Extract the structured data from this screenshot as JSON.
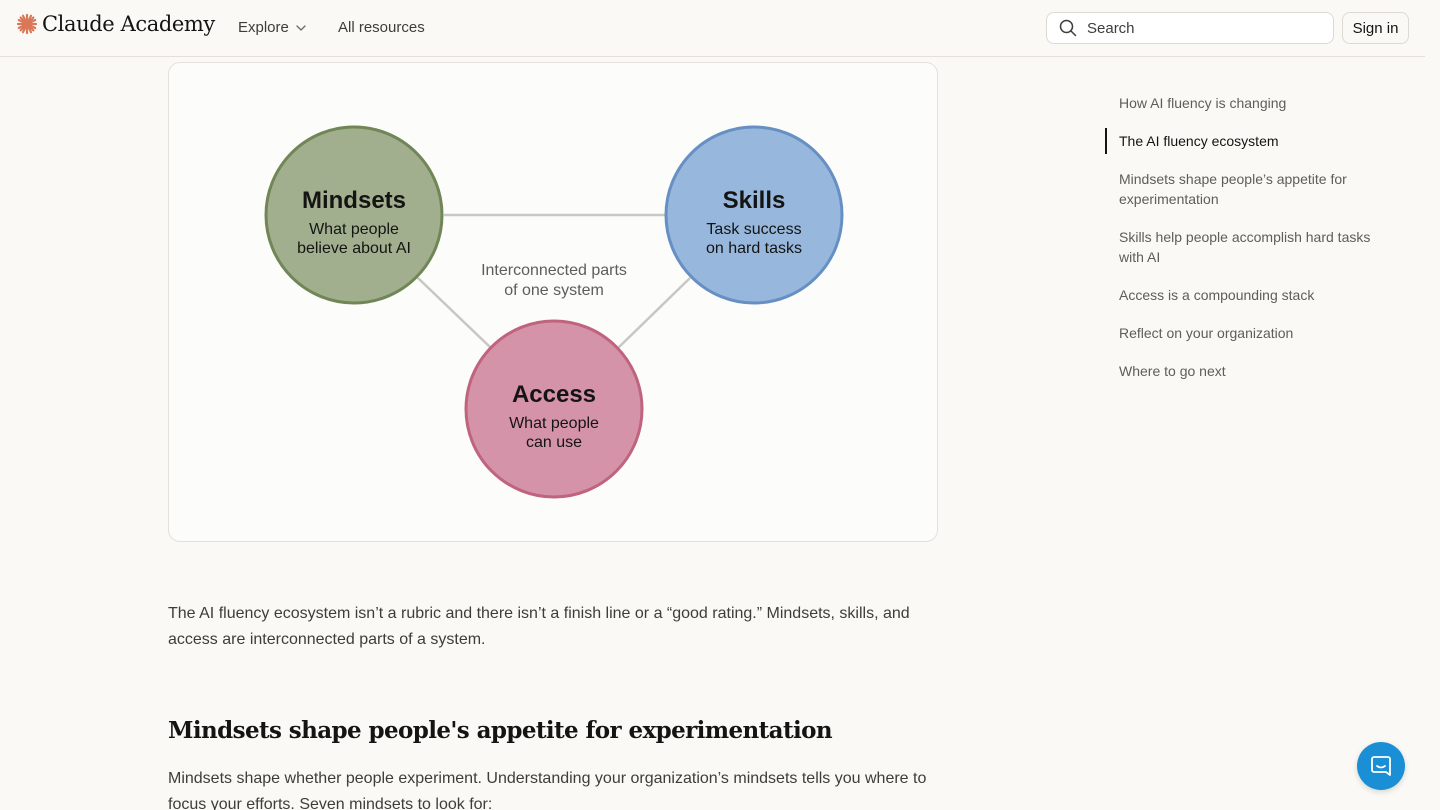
{
  "header": {
    "brand": "Claude Academy",
    "nav_explore": "Explore",
    "nav_all_resources": "All resources",
    "search_placeholder": "Search",
    "signin_label": "Sign in"
  },
  "diagram": {
    "center_label_line1": "Interconnected parts",
    "center_label_line2": "of one system",
    "nodes": [
      {
        "title": "Mindsets",
        "sub1": "What people",
        "sub2": "believe about AI",
        "fill": "#a2af8e",
        "stroke": "#718656"
      },
      {
        "title": "Skills",
        "sub1": "Task success",
        "sub2": "on hard tasks",
        "fill": "#97b7dc",
        "stroke": "#6690c4"
      },
      {
        "title": "Access",
        "sub1": "What people",
        "sub2": "can use",
        "fill": "#d593a9",
        "stroke": "#c0637e"
      }
    ],
    "connector_color": "#c8c7c2"
  },
  "content": {
    "paragraph1": "The AI fluency ecosystem isn’t a rubric and there isn’t a finish line or a “good rating.” Mindsets, skills, and access are interconnected parts of a system.",
    "heading": "Mindsets shape people's appetite for experimentation",
    "paragraph2": "Mindsets shape whether people experiment. Understanding your organization’s mindsets tells you where to focus your efforts. Seven mindsets to look for:"
  },
  "toc": {
    "items": [
      {
        "label": "How AI fluency is changing"
      },
      {
        "label": "The AI fluency ecosystem",
        "active": true
      },
      {
        "label": "Mindsets shape people’s appetite for experimentation"
      },
      {
        "label": "Skills help people accomplish hard tasks with AI"
      },
      {
        "label": "Access is a compounding stack"
      },
      {
        "label": "Reflect on your organization"
      },
      {
        "label": "Where to go next"
      }
    ]
  },
  "colors": {
    "accent": "#d97757",
    "chat_button": "#1a8fd6"
  },
  "icons": {
    "logo": "asterisk-burst-icon",
    "explore_chevron": "chevron-down-icon",
    "search": "search-icon",
    "chat": "chat-bubble-icon"
  }
}
